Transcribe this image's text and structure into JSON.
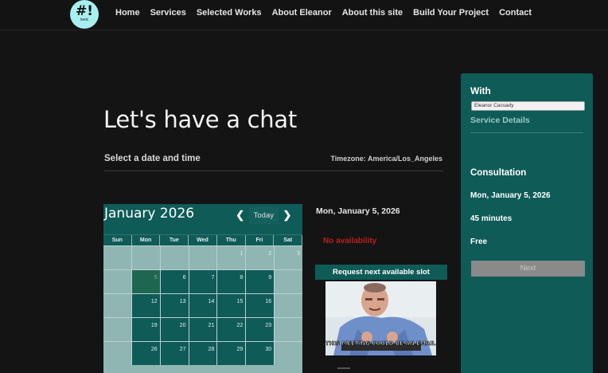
{
  "header": {
    "logo": {
      "mark": "#!",
      "small": "/eeic"
    },
    "nav": [
      "Home",
      "Services",
      "Selected Works",
      "About Eleanor",
      "About this site",
      "Build Your Project",
      "Contact"
    ]
  },
  "main": {
    "title": "Let's have a chat",
    "subtitle": "Select a date and time",
    "timezone": "Timezone: America/Los_Angeles"
  },
  "calendar": {
    "month_label": "January 2026",
    "prev_icon": "chevron-left-icon",
    "next_icon": "chevron-right-icon",
    "today_label": "Today",
    "weekdays": [
      "Sun",
      "Mon",
      "Tue",
      "Wed",
      "Thu",
      "Fri",
      "Sat"
    ],
    "weeks": [
      [
        "",
        "",
        "",
        "",
        "1",
        "2",
        "3"
      ],
      [
        "",
        "5",
        "6",
        "7",
        "8",
        "9",
        ""
      ],
      [
        "",
        "12",
        "13",
        "14",
        "15",
        "16",
        ""
      ],
      [
        "",
        "19",
        "20",
        "21",
        "22",
        "23",
        ""
      ],
      [
        "",
        "26",
        "27",
        "28",
        "29",
        "30",
        ""
      ]
    ]
  },
  "availability": {
    "selected_date": "Mon, January 5, 2026",
    "status": "No availability",
    "request_label": "Request next available slot",
    "image_caption": "THIS MEETING COULD BE AN EMAIL"
  },
  "panel": {
    "with_label": "With",
    "provider_value": "Eleanor Cassady",
    "service_details": "Service Details",
    "service": "Consultation",
    "date": "Mon, January 5, 2026",
    "duration": "45 minutes",
    "price": "Free",
    "next_label": "Next"
  },
  "colors": {
    "accent": "#0f5b58",
    "background": "#141414",
    "error": "#b81f1f",
    "logo": "#a8f0f0"
  }
}
